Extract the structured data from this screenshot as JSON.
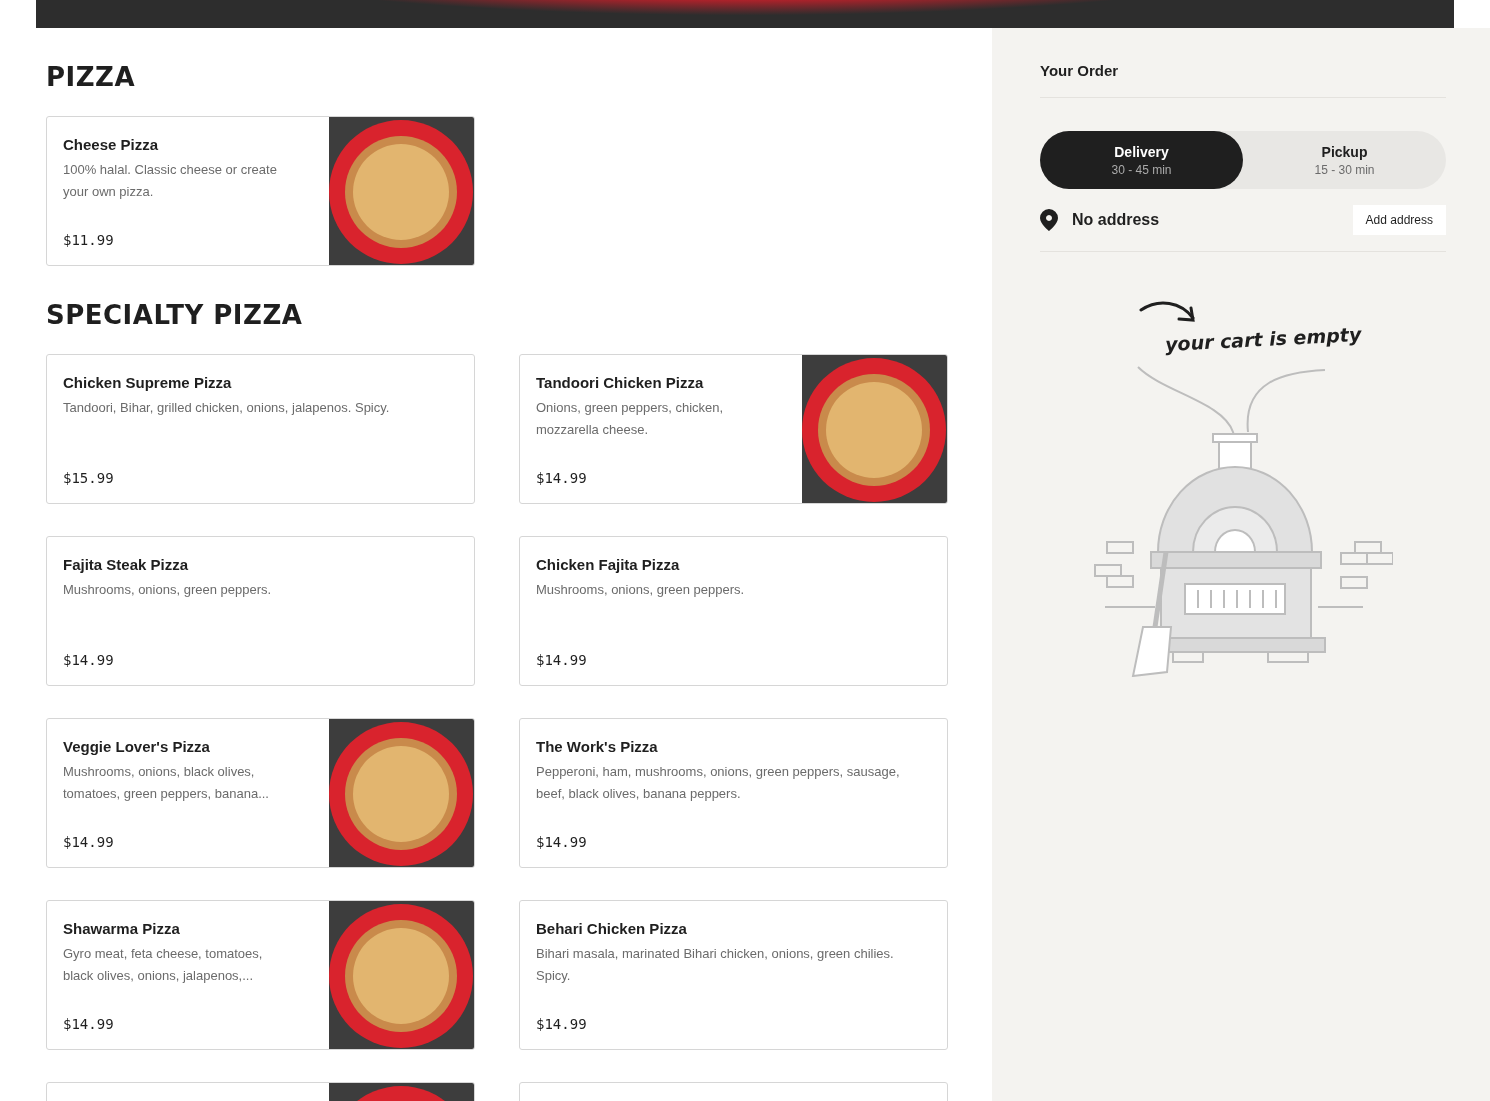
{
  "sections": [
    {
      "title": "PIZZA",
      "items": [
        {
          "name": "Cheese Pizza",
          "description": "100% halal. Classic cheese or create your own pizza.",
          "price": "$11.99",
          "image": true
        }
      ]
    },
    {
      "title": "SPECIALTY PIZZA",
      "items": [
        {
          "name": "Chicken Supreme Pizza",
          "description": "Tandoori, Bihar, grilled chicken, onions, jalapenos. Spicy.",
          "price": "$15.99",
          "image": false
        },
        {
          "name": "Tandoori Chicken Pizza",
          "description": "Onions, green peppers, chicken, mozzarella cheese.",
          "price": "$14.99",
          "image": true
        },
        {
          "name": "Fajita Steak Pizza",
          "description": "Mushrooms, onions, green peppers.",
          "price": "$14.99",
          "image": false
        },
        {
          "name": "Chicken Fajita Pizza",
          "description": "Mushrooms, onions, green peppers.",
          "price": "$14.99",
          "image": false
        },
        {
          "name": "Veggie Lover's Pizza",
          "description": "Mushrooms, onions, black olives, tomatoes, green peppers, banana...",
          "price": "$14.99",
          "image": true
        },
        {
          "name": "The Work's Pizza",
          "description": "Pepperoni, ham, mushrooms, onions, green peppers, sausage, beef, black olives, banana peppers.",
          "price": "$14.99",
          "image": false
        },
        {
          "name": "Shawarma Pizza",
          "description": "Gyro meat, feta cheese, tomatoes, black olives, onions, jalapenos,...",
          "price": "$14.99",
          "image": true
        },
        {
          "name": "Behari Chicken Pizza",
          "description": "Bihari masala, marinated Bihari chicken, onions, green chilies. Spicy.",
          "price": "$14.99",
          "image": false
        }
      ],
      "partial_cards": [
        {
          "image": true
        },
        {
          "image": false
        }
      ]
    }
  ],
  "order": {
    "title": "Your Order",
    "modes": [
      {
        "label": "Delivery",
        "time": "30 - 45 min",
        "selected": true
      },
      {
        "label": "Pickup",
        "time": "15 - 30 min",
        "selected": false
      }
    ],
    "address": "No address",
    "add_address": "Add address",
    "empty_message": "your cart is empty"
  }
}
